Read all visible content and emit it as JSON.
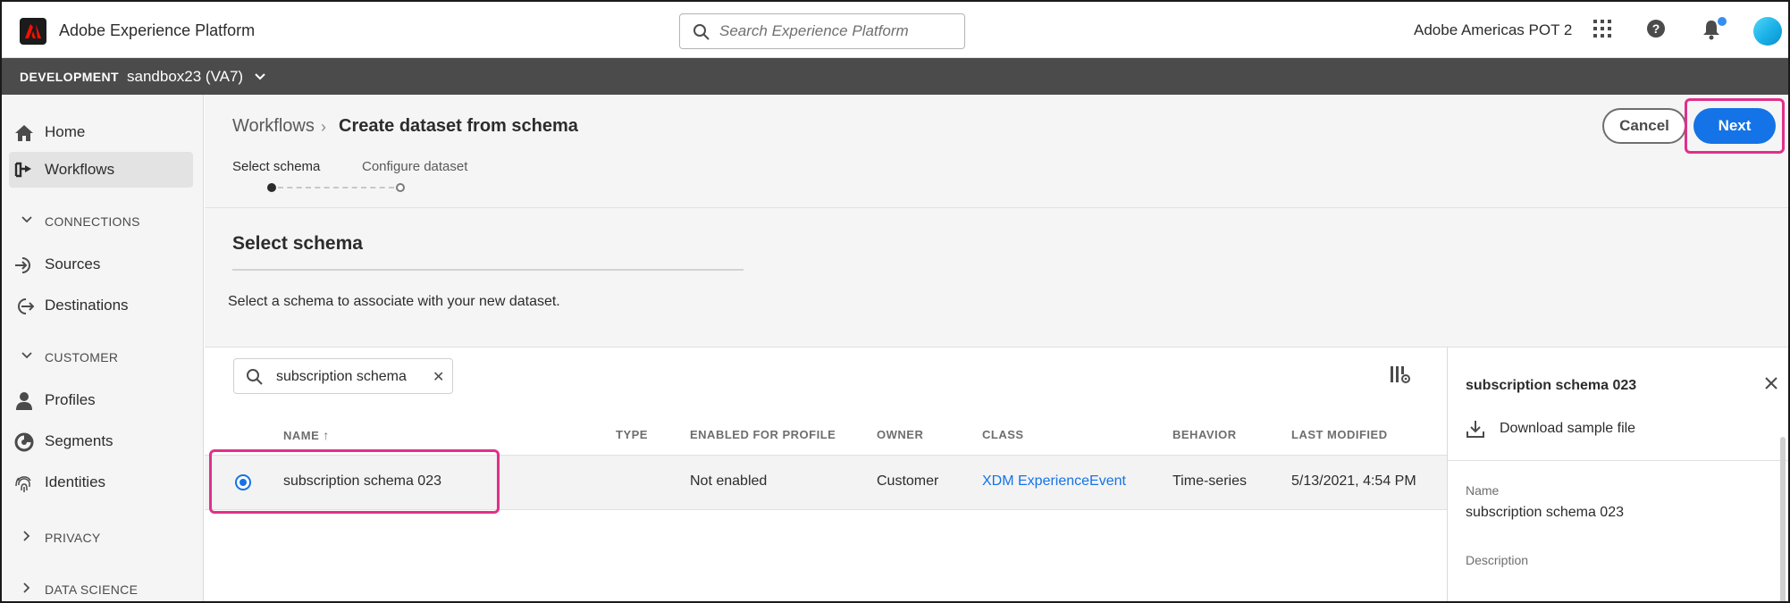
{
  "app": {
    "title": "Adobe Experience Platform"
  },
  "search": {
    "placeholder": "Search Experience Platform"
  },
  "header": {
    "org_name": "Adobe Americas POT 2"
  },
  "sandbox": {
    "environment": "DEVELOPMENT",
    "name": "sandbox23 (VA7)"
  },
  "nav": {
    "items": [
      {
        "label": "Home",
        "icon": "home-icon"
      },
      {
        "label": "Workflows",
        "icon": "workflows-icon",
        "active": true
      }
    ],
    "connections": {
      "label": "CONNECTIONS",
      "items": [
        {
          "label": "Sources",
          "icon": "sources-icon"
        },
        {
          "label": "Destinations",
          "icon": "destinations-icon"
        }
      ]
    },
    "customer": {
      "label": "CUSTOMER",
      "items": [
        {
          "label": "Profiles",
          "icon": "profiles-icon"
        },
        {
          "label": "Segments",
          "icon": "segments-icon"
        },
        {
          "label": "Identities",
          "icon": "identities-icon"
        }
      ]
    },
    "privacy": {
      "label": "PRIVACY"
    },
    "data_science": {
      "label": "DATA SCIENCE"
    }
  },
  "breadcrumb": {
    "parent": "Workflows",
    "current": "Create dataset from schema"
  },
  "steps": [
    {
      "label": "Select schema",
      "state": "current"
    },
    {
      "label": "Configure dataset",
      "state": "pending"
    }
  ],
  "actions": {
    "cancel": "Cancel",
    "next": "Next"
  },
  "section": {
    "title": "Select schema",
    "description": "Select a schema to associate with your new dataset."
  },
  "table": {
    "search_value": "subscription schema",
    "columns": [
      "NAME",
      "TYPE",
      "ENABLED FOR PROFILE",
      "OWNER",
      "CLASS",
      "BEHAVIOR",
      "LAST MODIFIED"
    ],
    "sort": {
      "column": "NAME",
      "direction": "ascending"
    },
    "rows": [
      {
        "selected": true,
        "name": "subscription schema 023",
        "type": "",
        "enabled_for_profile": "Not enabled",
        "owner": "Customer",
        "class": "XDM ExperienceEvent",
        "behavior": "Time-series",
        "last_modified": "5/13/2021, 4:54 PM"
      }
    ]
  },
  "rail": {
    "title": "subscription schema 023",
    "download_label": "Download sample file",
    "name_label": "Name",
    "name_value": "subscription schema 023",
    "description_label": "Description"
  },
  "colors": {
    "accent": "#1473e6",
    "highlight": "#e0308a",
    "sandbox_bar": "#4b4b4b",
    "notification_dot": "#378ef0"
  }
}
